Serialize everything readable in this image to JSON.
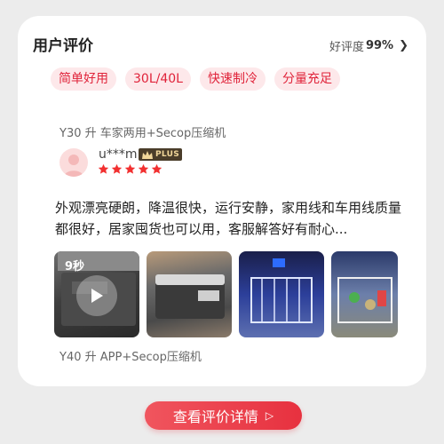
{
  "header": {
    "title": "用户评价",
    "rating_label": "好评度",
    "rating_value": "99%",
    "chevron_icon": "chevron-right-icon"
  },
  "tags": [
    "简单好用",
    "30L/40L",
    "快速制冷",
    "分量充足"
  ],
  "review": {
    "variant": "Y30 升 车家两用+Secop压缩机",
    "username": "u***m",
    "badge": "PLUS",
    "stars": 5,
    "text": "外观漂亮硬朗，降温很快，运行安静，家用线和车用线质量都很好，居家囤货也可以用，客服解答好有耐心...",
    "video_duration": "9秒"
  },
  "next_variant": "Y40 升 APP+Secop压缩机",
  "cta": {
    "label": "查看评价详情",
    "icon": "play-triangle-icon"
  },
  "colors": {
    "accent": "#e7313f",
    "tag_bg": "#fde8ea",
    "star": "#f23030"
  }
}
